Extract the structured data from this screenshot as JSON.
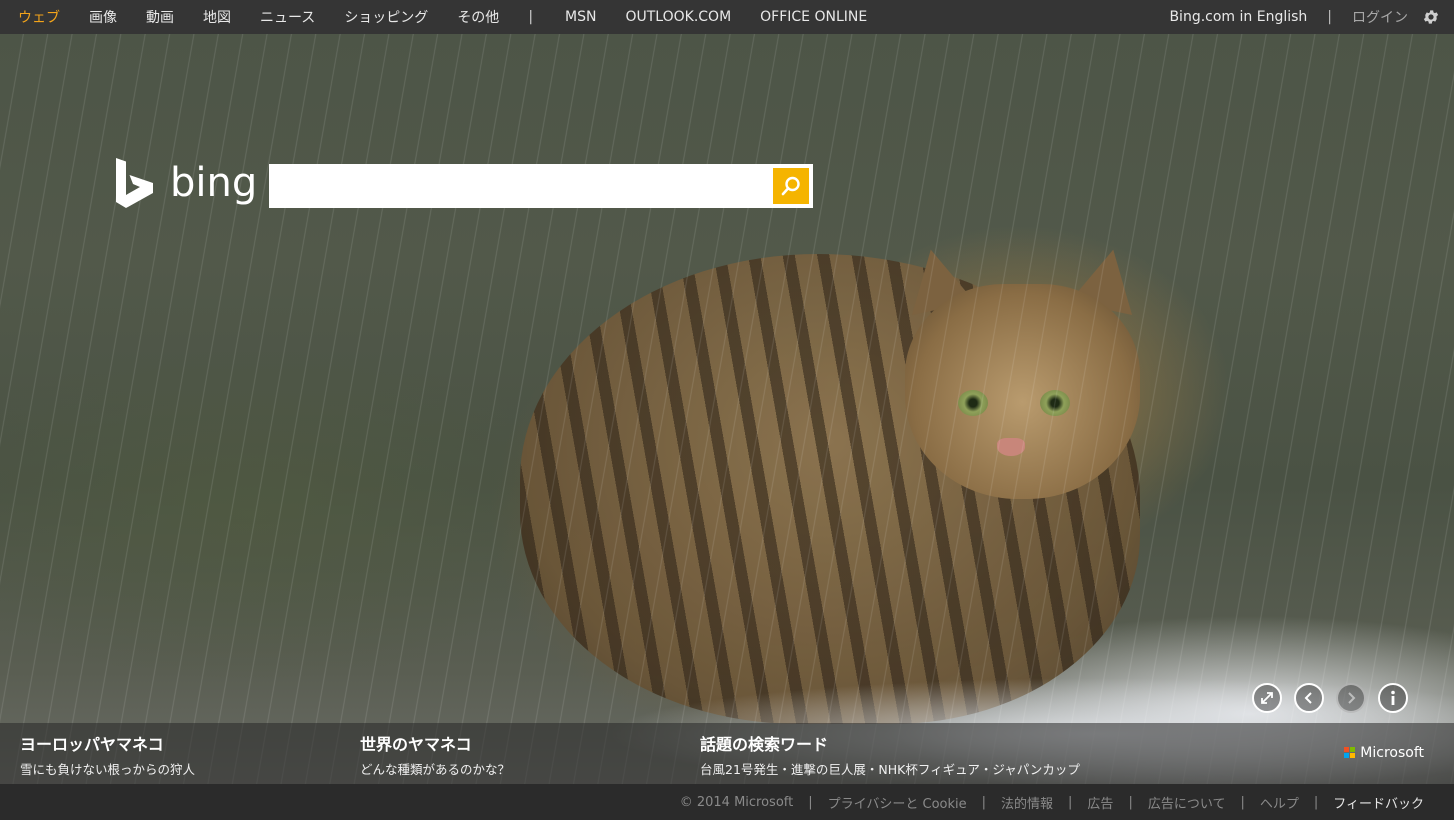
{
  "nav": {
    "left": [
      {
        "label": "ウェブ",
        "active": true
      },
      {
        "label": "画像"
      },
      {
        "label": "動画"
      },
      {
        "label": "地図"
      },
      {
        "label": "ニュース"
      },
      {
        "label": "ショッピング"
      },
      {
        "label": "その他"
      }
    ],
    "separator": "|",
    "links": [
      "MSN",
      "OUTLOOK.COM",
      "OFFICE ONLINE"
    ],
    "right": {
      "english": "Bing.com in English",
      "separator": "|",
      "login": "ログイン",
      "settings_icon": "gear-icon"
    }
  },
  "brand": {
    "logo_text": "bing",
    "logo_icon": "bing-b-icon"
  },
  "search": {
    "value": "",
    "placeholder": "",
    "button_icon": "magnifier-icon",
    "accent": "#f5b400"
  },
  "carousel": {
    "controls": [
      {
        "name": "fullscreen-icon"
      },
      {
        "name": "previous-icon"
      },
      {
        "name": "next-icon",
        "disabled": true
      },
      {
        "name": "info-icon"
      }
    ]
  },
  "captions": [
    {
      "title": "ヨーロッパヤマネコ",
      "subtitle": "雪にも負けない根っからの狩人"
    },
    {
      "title": "世界のヤマネコ",
      "subtitle": "どんな種類があるのかな？"
    },
    {
      "title": "話題の検索ワード",
      "subtitle": "台風21号発生・進撃の巨人展・NHK杯フィギュア・ジャパンカップ"
    }
  ],
  "microsoft": {
    "label": "Microsoft",
    "colors": [
      "#f25022",
      "#7fba00",
      "#00a4ef",
      "#ffb900"
    ]
  },
  "footer": {
    "items": [
      "© 2014 Microsoft",
      "プライバシーと Cookie",
      "法的情報",
      "広告",
      "広告について",
      "ヘルプ",
      "フィードバック"
    ],
    "separator": "|"
  }
}
